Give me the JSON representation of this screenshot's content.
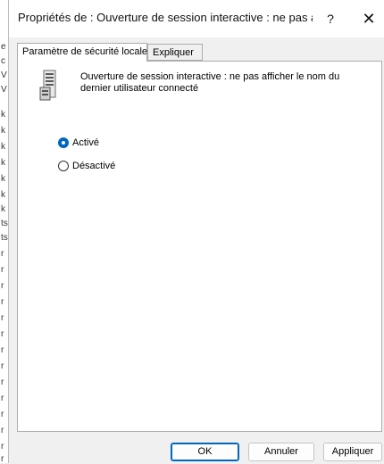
{
  "dialog": {
    "title": "Propriétés de : Ouverture de session interactive : ne pas a...",
    "help_label": "?",
    "close_label": "✕"
  },
  "tabs": [
    {
      "label": "Paramètre de sécurité locale",
      "active": true
    },
    {
      "label": "Expliquer",
      "active": false
    }
  ],
  "policy": {
    "icon": "policy-document-icon",
    "description": "Ouverture de session interactive : ne pas afficher le nom du dernier utilisateur connecté"
  },
  "options": [
    {
      "label": "Activé",
      "checked": true
    },
    {
      "label": "Désactivé",
      "checked": false
    }
  ],
  "buttons": {
    "ok": "OK",
    "cancel": "Annuler",
    "apply": "Appliquer"
  },
  "background_strip_glyphs": [
    "e",
    "c",
    "V",
    "V",
    "k",
    "k",
    "k",
    "k",
    "k",
    "k",
    "k",
    "ts",
    "ts",
    "r",
    "r",
    "r",
    "r",
    "r",
    "r",
    "r",
    "r",
    "r",
    "r",
    "r",
    "r",
    "r",
    "r"
  ],
  "colors": {
    "accent": "#0067c0",
    "window_bg": "#f0f0f0",
    "panel_bg": "#ffffff"
  }
}
